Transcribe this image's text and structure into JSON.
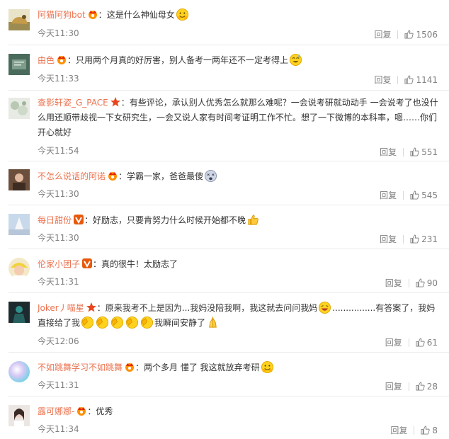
{
  "comments": [
    {
      "user": "阿猫阿狗bot",
      "badge": "crown",
      "text": "这是什么神仙母女",
      "emoji_after": "hug",
      "time": "今天11:30",
      "reply": "回复",
      "likes": "1506"
    },
    {
      "user": "由色",
      "badge": "crown",
      "text": "只用两个月真的好厉害，别人备考一两年还不一定考得上",
      "emoji_after": "sweat",
      "time": "今天11:33",
      "reply": "回复",
      "likes": "1141"
    },
    {
      "user": "查影轩姿_G_PACE",
      "badge": "star",
      "text": "有些评论，承认别人优秀怎么就那么难呢？一会说考研就动动手 一会说考了也没什么用还顺带歧视一下女研究生，一会又说人家有时间考证明工作不忙。想了一下微博的本科率，嗯……你们开心就好",
      "time": "今天11:54",
      "reply": "回复",
      "likes": "551"
    },
    {
      "user": "不怎么说话的阿诺",
      "badge": "crown",
      "text": "学霸一家，爸爸最傻",
      "emoji_after": "dizzy",
      "time": "今天11:30",
      "reply": "回复",
      "likes": "545"
    },
    {
      "user": "每日甜份",
      "badge": "v",
      "text": "好励志，只要肯努力什么时候开始都不晚",
      "emoji_after": "thumb",
      "time": "今天11:30",
      "reply": "回复",
      "likes": "231"
    },
    {
      "user": "伦家小团子",
      "badge": "v",
      "text": "真的很牛！太励志了",
      "time": "今天11:31",
      "reply": "回复",
      "likes": "90"
    },
    {
      "user": "Joker丿喵星",
      "badge": "star",
      "text_a": "原来我考不上是因为...我妈没陪我啊，我这就去问问我妈",
      "text_b": "................有答案了，我妈直接给了我",
      "text_c": "我瞬间安静了",
      "time": "今天12:06",
      "reply": "回复",
      "likes": "61"
    },
    {
      "user": "不如跳舞学习不如跳舞",
      "badge": "crown",
      "text": "两个多月 懂了 我这就放弃考研",
      "emoji_after": "hug",
      "time": "今天11:31",
      "reply": "回复",
      "likes": "28"
    },
    {
      "user": "露可娜娜-",
      "badge": "crown",
      "text": "优秀",
      "time": "今天11:34",
      "reply": "回复",
      "likes": "8"
    }
  ],
  "colors": {
    "username": "#eb7350",
    "meta": "#808080",
    "text": "#333333"
  }
}
